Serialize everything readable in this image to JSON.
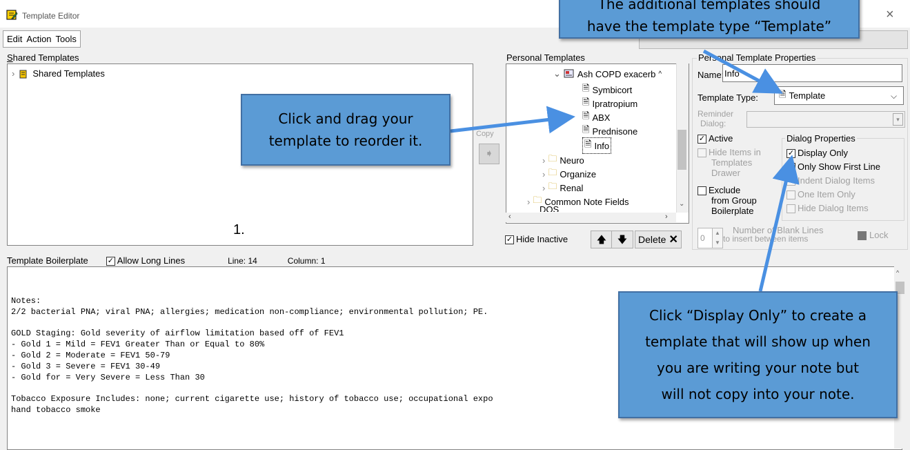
{
  "window": {
    "title": "Template Editor",
    "close": "×"
  },
  "menu": [
    "Edit",
    "Action",
    "Tools"
  ],
  "shared": {
    "label": "Shared Templates",
    "root": "Shared Templates"
  },
  "copy": {
    "label": "Copy",
    "arrow": "➧"
  },
  "personal": {
    "label": "Personal Templates",
    "items": [
      {
        "label": "Ash COPD exacerb",
        "chevron": "⌄",
        "icon": "folder-open-icon"
      },
      {
        "label": "Symbicort"
      },
      {
        "label": "Ipratropium"
      },
      {
        "label": "ABX"
      },
      {
        "label": "Prednisone"
      },
      {
        "label": "Info"
      },
      {
        "label": "Neuro",
        "chevron": "›"
      },
      {
        "label": "Organize",
        "chevron": "›"
      },
      {
        "label": "Renal",
        "chevron": "›"
      },
      {
        "label": "Common Note Fields",
        "chevron": "›"
      },
      {
        "label": "DOS"
      }
    ],
    "hide_inactive": "Hide Inactive",
    "delete": "Delete"
  },
  "props": {
    "label": "Personal Template Properties",
    "name_label": "Name:",
    "name_value": "Info",
    "type_label": "Template Type:",
    "type_value": "Template",
    "reminder_label": "Reminder",
    "reminder_label2": "Dialog:",
    "active": "Active",
    "hide_items": [
      "Hide Items in",
      "Templates",
      "Drawer"
    ],
    "exclude": [
      "Exclude",
      "from Group",
      "Boilerplate"
    ],
    "dialog_props": "Dialog Properties",
    "display_only": "Display Only",
    "only_first": "Only Show First Line",
    "indent": "Indent Dialog Items",
    "one_item": "One Item Only",
    "hide_dialog": "Hide Dialog Items",
    "blank_value": "0",
    "blank_label": [
      "Number of Blank Lines",
      "to insert between items"
    ],
    "lock": "Lock"
  },
  "boilerplate": {
    "label": "Template Boilerplate",
    "allow_long": "Allow Long Lines",
    "line": "Line: 14",
    "column": "Column: 1",
    "text": "Notes:\n2/2 bacterial PNA; viral PNA; allergies; medication non-compliance; environmental pollution; PE.\n\nGOLD Staging: Gold severity of airflow limitation based off of FEV1\n- Gold 1 = Mild = FEV1 Greater Than or Equal to 80%\n- Gold 2 = Moderate = FEV1 50-79\n- Gold 3 = Severe = FEV1 30-49\n- Gold for = Very Severe = Less Than 30\n\nTobacco Exposure Includes: none; current cigarette use; history of tobacco use; occupational expo\nhand tobacco smoke"
  },
  "step_marker": "1.",
  "callouts": {
    "top": [
      "The additional templates should",
      "have the template type “Template”"
    ],
    "left": [
      "Click and drag your",
      "template to reorder it."
    ],
    "right": [
      "Click “Display Only” to create a",
      "template that will show up when",
      "you are writing your note but",
      "will not copy into your note."
    ]
  },
  "colors": {
    "callout_fill": "#5b9bd5",
    "callout_border": "#416fa3",
    "arrow": "#4a90e2"
  }
}
